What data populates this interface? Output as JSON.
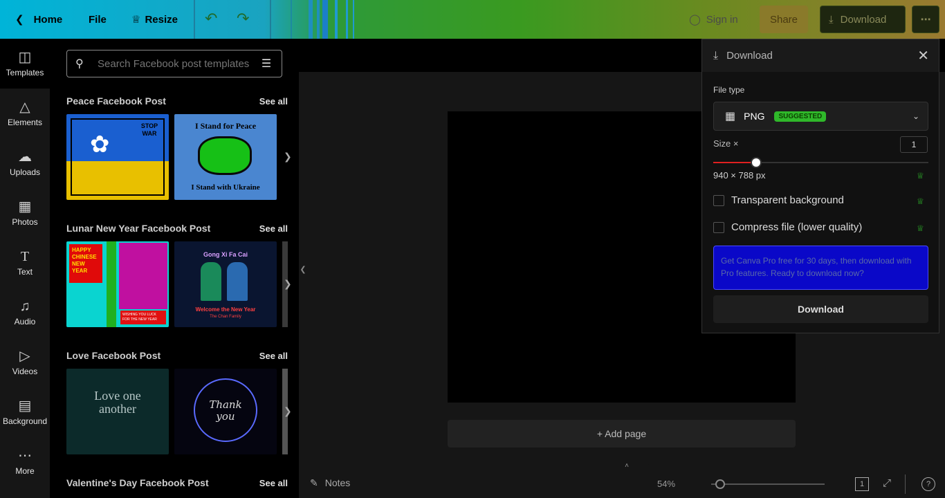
{
  "topbar": {
    "home_label": "Home",
    "file_label": "File",
    "resize_label": "Resize",
    "signin_label": "Sign in",
    "share_label": "Share",
    "download_label": "Download"
  },
  "sidenav": {
    "items": [
      {
        "label": "Templates",
        "icon": "templates-icon"
      },
      {
        "label": "Elements",
        "icon": "elements-icon"
      },
      {
        "label": "Uploads",
        "icon": "upload-icon"
      },
      {
        "label": "Photos",
        "icon": "photo-icon"
      },
      {
        "label": "Text",
        "icon": "text-icon"
      },
      {
        "label": "Audio",
        "icon": "music-icon"
      },
      {
        "label": "Videos",
        "icon": "video-icon"
      },
      {
        "label": "Background",
        "icon": "background-icon"
      },
      {
        "label": "More",
        "icon": "more-icon"
      }
    ]
  },
  "panel": {
    "search_placeholder": "Search Facebook post templates",
    "see_all": "See all",
    "sections": [
      {
        "title": "Peace Facebook Post",
        "thumbs": [
          {
            "text": "STOP WAR"
          },
          {
            "text_top": "I Stand for Peace",
            "text_bottom": "I Stand with Ukraine"
          }
        ]
      },
      {
        "title": "Lunar New Year Facebook Post",
        "thumbs": [
          {
            "text": "HAPPY CHINESE NEW YEAR",
            "small": "WISHING YOU LUCK FOR THE NEW YEAR"
          },
          {
            "text_top": "Gong Xi Fa Cai",
            "text_bottom": "Welcome the New Year",
            "small": "The Chan Family"
          }
        ]
      },
      {
        "title": "Love Facebook Post",
        "thumbs": [
          {
            "text": "Love one another"
          },
          {
            "text": "Thank you"
          }
        ]
      },
      {
        "title": "Valentine's Day Facebook Post"
      }
    ]
  },
  "workspace": {
    "add_page_label": "+ Add page",
    "notes_label": "Notes",
    "zoom_value": "54%",
    "page_number": "1"
  },
  "download_panel": {
    "title": "Download",
    "file_type_label": "File type",
    "file_type_value": "PNG",
    "suggested_badge": "SUGGESTED",
    "size_label": "Size ×",
    "size_value": "1",
    "size_fraction": 0.2,
    "dimensions": "940 × 788 px",
    "transparent_label": "Transparent background",
    "compress_label": "Compress file (lower quality)",
    "banner_text": "Get Canva Pro free for 30 days, then download with Pro features. Ready to download now?",
    "download_button": "Download"
  },
  "colors": {
    "accent_green": "#2fb82a",
    "slider_red": "#e02020",
    "banner_blue": "#0a08c8"
  }
}
